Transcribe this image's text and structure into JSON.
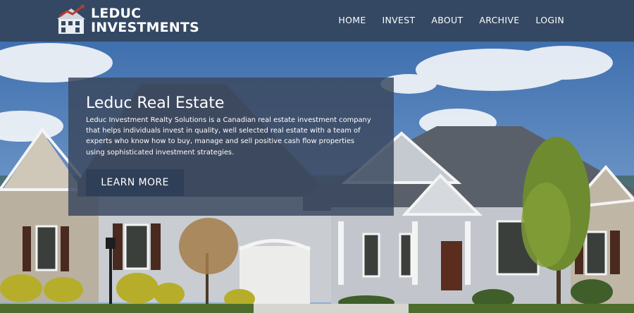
{
  "brand": {
    "line1": "LEDUC",
    "line2": "INVESTMENTS"
  },
  "nav": {
    "items": [
      {
        "label": "HOME"
      },
      {
        "label": "INVEST"
      },
      {
        "label": "ABOUT"
      },
      {
        "label": "ARCHIVE"
      },
      {
        "label": "LOGIN"
      }
    ]
  },
  "hero": {
    "title": "Leduc Real Estate",
    "description": "Leduc Investment Realty Solutions is a Canadian real estate investment company that helps individuals invest in quality, well selected real estate with a team of experts who know how to buy, manage and sell positive cash flow properties using sophisticated investment strategies.",
    "cta_label": "LEARN MORE"
  },
  "colors": {
    "navbar": "#344863",
    "card": "#3a485e",
    "button": "#2f3f57",
    "sky": "#5b86bd"
  }
}
